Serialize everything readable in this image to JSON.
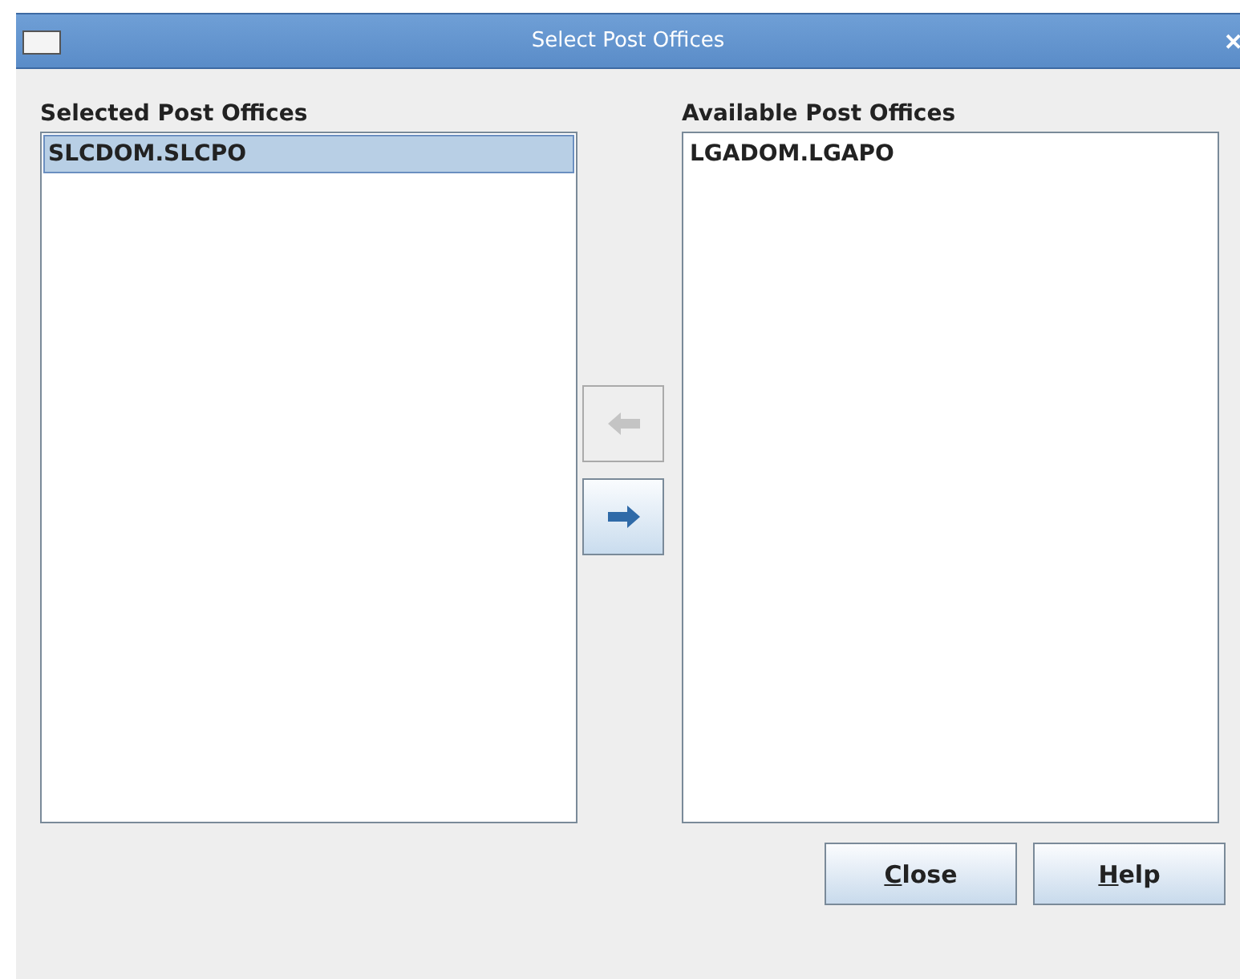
{
  "window": {
    "title": "Select Post Offices",
    "close": "✕"
  },
  "selected_list": {
    "heading": "Selected Post Offices",
    "items": [
      {
        "label": "SLCDOM.SLCPO",
        "selected": true
      }
    ]
  },
  "move_buttons": [
    {
      "kind": "left",
      "disabled": true
    },
    {
      "kind": "right",
      "disabled": false
    }
  ],
  "available_list": {
    "heading": "Available Post Offices",
    "items": [
      {
        "label": "LGADOM.LGAPO",
        "selected": false
      }
    ]
  },
  "buttons": [
    {
      "label": "Close"
    },
    {
      "label": "Help"
    }
  ]
}
